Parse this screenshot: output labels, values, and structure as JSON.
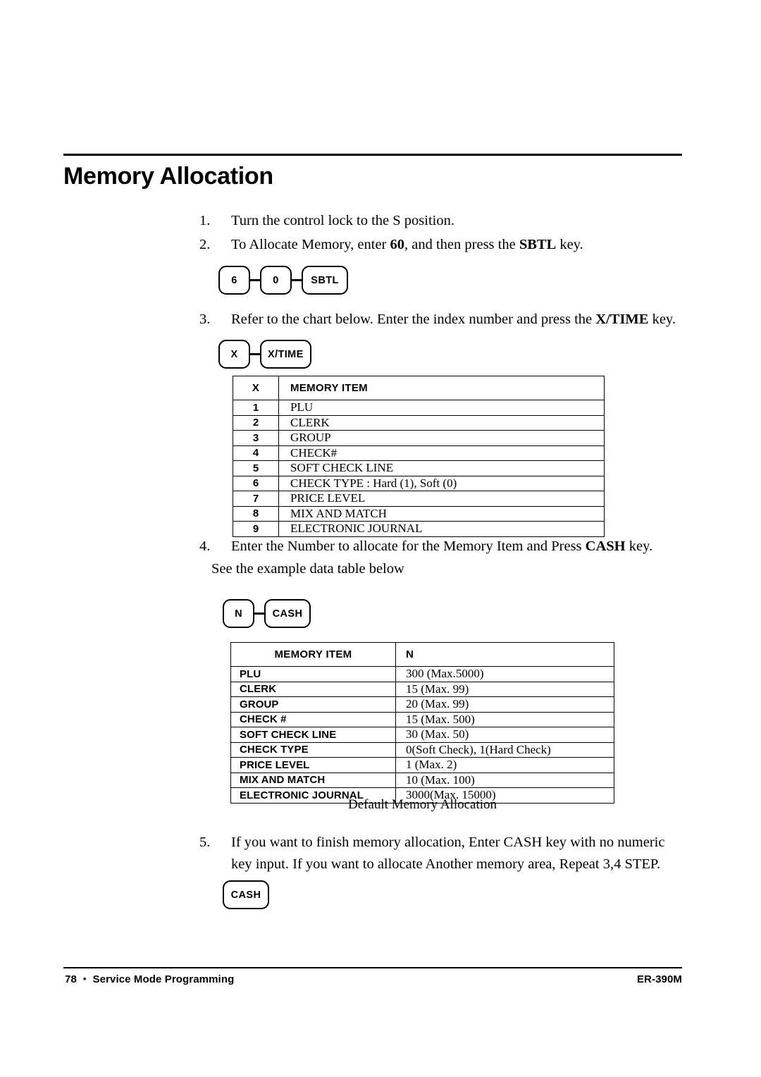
{
  "document": {
    "title": "Memory Allocation"
  },
  "steps": {
    "step1": {
      "num": "1.",
      "text": "Turn the control lock to the S position."
    },
    "step2": {
      "num": "2.",
      "pre": "To Allocate Memory, enter ",
      "bold1": "60",
      "mid": ", and then press the ",
      "bold2": "SBTL",
      "post": " key."
    },
    "step3": {
      "num": "3.",
      "pre": "Refer to the chart below. Enter the index number and press the ",
      "bold1": "X/TIME",
      "post": " key."
    },
    "step4": {
      "num": "4.",
      "pre": "Enter the Number to allocate for the Memory Item and Press ",
      "bold1": "CASH",
      "post": " key.",
      "sub": "See the example data table below"
    },
    "step5": {
      "num": "5.",
      "text": "If you want to finish memory allocation, Enter CASH key with no numeric key input. If you want to allocate Another memory area, Repeat 3,4 STEP."
    }
  },
  "key_sequences": {
    "sbtl": [
      "6",
      "0",
      "SBTL"
    ],
    "xtime": [
      "X",
      "X/TIME"
    ],
    "ncash": [
      "N",
      "CASH"
    ],
    "cash": [
      "CASH"
    ]
  },
  "index_table": {
    "headers": [
      "X",
      "MEMORY ITEM"
    ],
    "rows": [
      {
        "x": "1",
        "item": "PLU"
      },
      {
        "x": "2",
        "item": "CLERK"
      },
      {
        "x": "3",
        "item": "GROUP"
      },
      {
        "x": "4",
        "item": "CHECK#"
      },
      {
        "x": "5",
        "item": "SOFT CHECK LINE"
      },
      {
        "x": "6",
        "item": "CHECK TYPE : Hard (1), Soft (0)"
      },
      {
        "x": "7",
        "item": "PRICE LEVEL"
      },
      {
        "x": "8",
        "item": "MIX AND MATCH"
      },
      {
        "x": "9",
        "item": "ELECTRONIC JOURNAL"
      }
    ]
  },
  "default_table": {
    "headers": [
      "MEMORY ITEM",
      "N"
    ],
    "caption": "Default Memory Allocation",
    "rows": [
      {
        "item": "PLU",
        "n": "300 (Max.5000)"
      },
      {
        "item": "CLERK",
        "n": "15 (Max. 99)"
      },
      {
        "item": "GROUP",
        "n": "20 (Max. 99)"
      },
      {
        "item": "CHECK #",
        "n": "15 (Max. 500)"
      },
      {
        "item": "SOFT CHECK LINE",
        "n": "30 (Max. 50)"
      },
      {
        "item": "CHECK TYPE",
        "n": "0(Soft Check), 1(Hard Check)"
      },
      {
        "item": "PRICE LEVEL",
        "n": "1 (Max. 2)"
      },
      {
        "item": "MIX AND MATCH",
        "n": "10 (Max. 100)"
      },
      {
        "item": "ELECTRONIC JOURNAL",
        "n": "3000(Max. 15000)"
      }
    ]
  },
  "footer": {
    "page_number": "78",
    "bullet": "•",
    "section": "Service Mode Programming",
    "model": "ER-390M"
  }
}
